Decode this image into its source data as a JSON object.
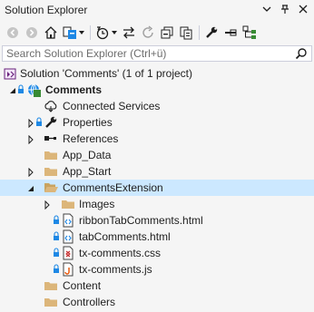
{
  "window": {
    "title": "Solution Explorer"
  },
  "search": {
    "placeholder": "Search Solution Explorer (Ctrl+ü)"
  },
  "tree": [
    {
      "label": "Solution 'Comments' (1 of 1 project)",
      "kind": "solution-icon"
    },
    {
      "label": "Comments",
      "kind": "web-project-icon",
      "bold": true
    },
    {
      "label": "Connected Services",
      "kind": "connected-services-icon"
    },
    {
      "label": "Properties",
      "kind": "wrench-icon"
    },
    {
      "label": "References",
      "kind": "references-icon"
    },
    {
      "label": "App_Data",
      "kind": "folder-icon"
    },
    {
      "label": "App_Start",
      "kind": "folder-icon"
    },
    {
      "label": "CommentsExtension",
      "kind": "folder-open-icon",
      "selected": true
    },
    {
      "label": "Images",
      "kind": "folder-icon"
    },
    {
      "label": "ribbonTabComments.html",
      "kind": "html-file-icon"
    },
    {
      "label": "tabComments.html",
      "kind": "html-file-icon"
    },
    {
      "label": "tx-comments.css",
      "kind": "css-file-icon"
    },
    {
      "label": "tx-comments.js",
      "kind": "js-file-icon"
    },
    {
      "label": "Content",
      "kind": "folder-icon"
    },
    {
      "label": "Controllers",
      "kind": "folder-icon"
    }
  ],
  "colors": {
    "selection": "#cce8ff",
    "folder": "#dcb67a",
    "lock": "#1e88e5",
    "background": "#f5f5f5"
  }
}
